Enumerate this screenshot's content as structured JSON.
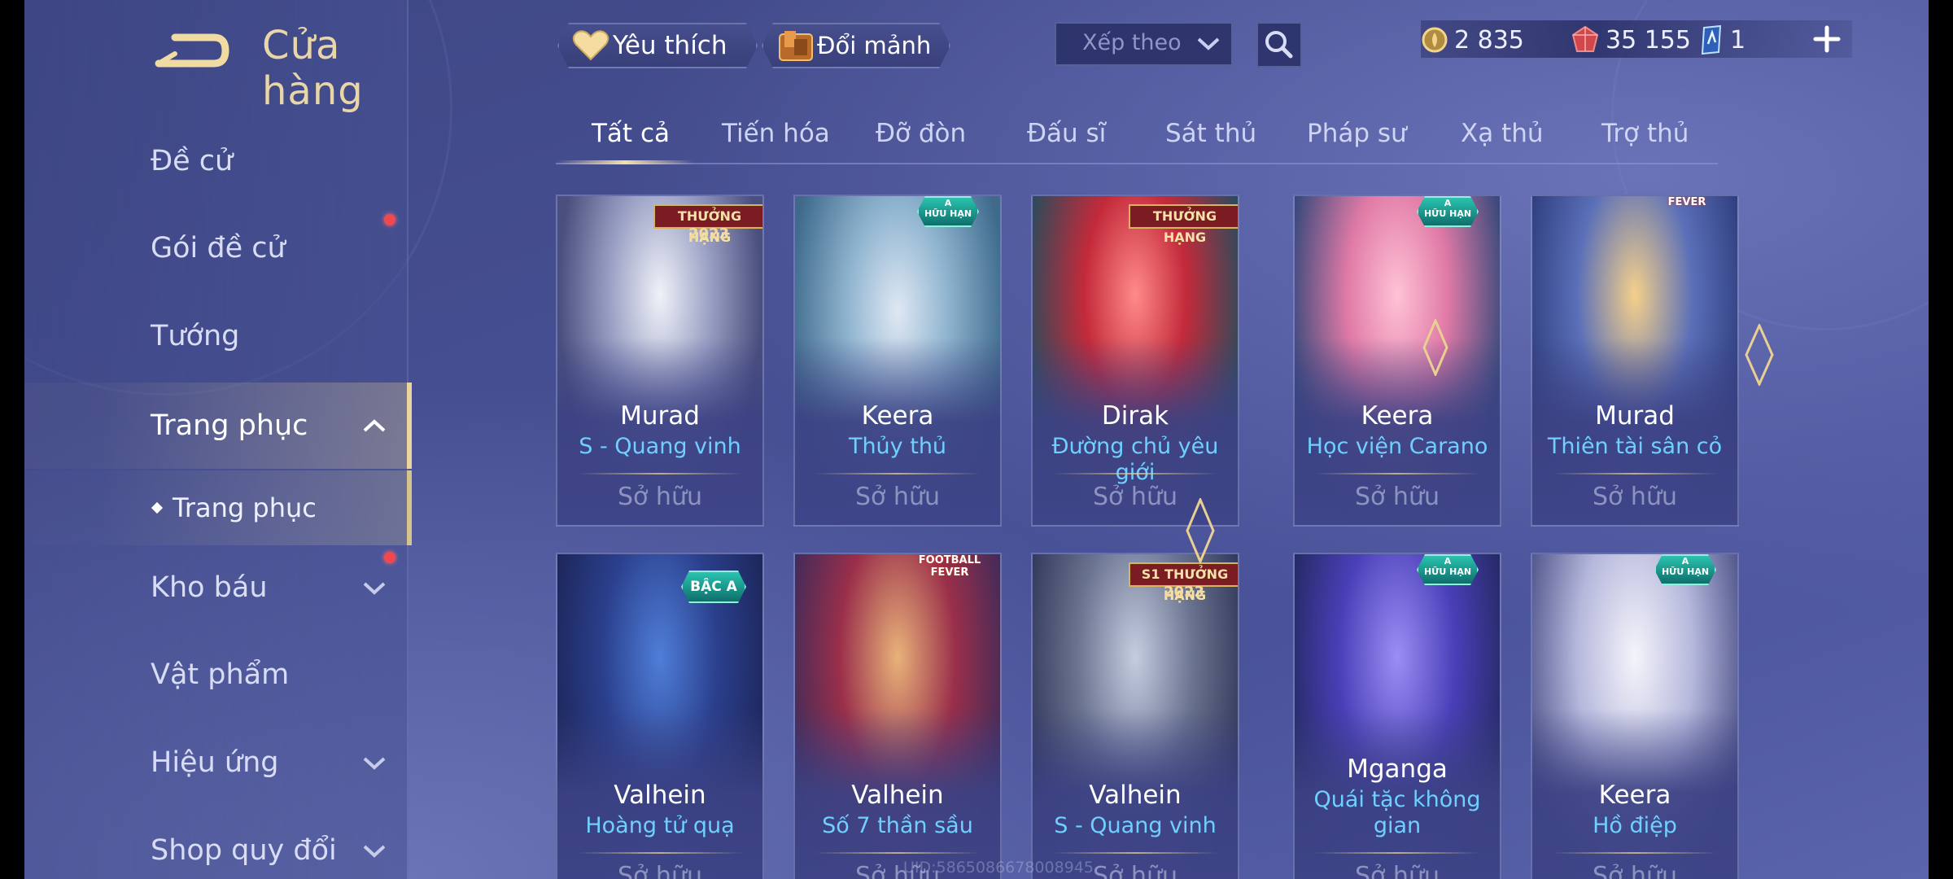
{
  "header": {
    "title": "Cửa hàng",
    "favorite_label": "Yêu thích",
    "exchange_label": "Đổi mảnh",
    "sort_label": "Xếp theo"
  },
  "currency": {
    "gold": "2 835",
    "vouchers": "35 155",
    "tickets": "1"
  },
  "sidebar": {
    "items": [
      {
        "label": "Đề cử"
      },
      {
        "label": "Gói đề cử"
      },
      {
        "label": "Tướng"
      },
      {
        "label": "Trang phục"
      },
      {
        "label": "Trang phục"
      },
      {
        "label": "Kho báu"
      },
      {
        "label": "Vật phẩm"
      },
      {
        "label": "Hiệu ứng"
      },
      {
        "label": "Shop quy đổi"
      }
    ]
  },
  "tabs": [
    "Tất cả",
    "Tiến hóa",
    "Đỡ đòn",
    "Đấu sĩ",
    "Sát thủ",
    "Pháp sư",
    "Xạ thủ",
    "Trợ thủ"
  ],
  "cards": [
    {
      "hero": "Murad",
      "skin": "S - Quang vinh",
      "status": "Sở hữu",
      "badge": "THƯỞNG HẠNG",
      "badge_year": "2023"
    },
    {
      "hero": "Keera",
      "skin": "Thủy thủ",
      "status": "Sở hữu",
      "badge": "HỮU HẠN"
    },
    {
      "hero": "Dirak",
      "skin": "Đường chủ yêu giới",
      "status": "Sở hữu",
      "badge": "THƯỞNG HẠNG"
    },
    {
      "hero": "Keera",
      "skin": "Học viện Carano",
      "status": "Sở hữu",
      "badge": "HỮU HẠN"
    },
    {
      "hero": "Murad",
      "skin": "Thiên tài sân cỏ",
      "status": "Sở hữu",
      "badge": "FEVER"
    },
    {
      "hero": "Valhein",
      "skin": "Hoàng tử quạ",
      "status": "Sở hữu",
      "badge": "BẬC A"
    },
    {
      "hero": "Valhein",
      "skin": "Số 7 thần sầu",
      "status": "Sở hữu",
      "badge": "FOOTBALL FEVER"
    },
    {
      "hero": "Valhein",
      "skin": "S - Quang vinh",
      "status": "Sở hữu",
      "badge": "S1 THƯỞNG HẠNG",
      "badge_year": "2023"
    },
    {
      "hero": "Mganga",
      "skin": "Quái tặc không gian",
      "status": "Sở hữu",
      "badge": "HỮU HẠN"
    },
    {
      "hero": "Keera",
      "skin": "Hồ điệp",
      "status": "Sở hữu",
      "badge": "HỮU HẠN"
    }
  ],
  "footer_id": "UID:5865086678008945",
  "colors": {
    "accent_gold": "#e8d6a8",
    "skin_blue": "#6fd0ff",
    "alert_red": "#f0484e"
  }
}
